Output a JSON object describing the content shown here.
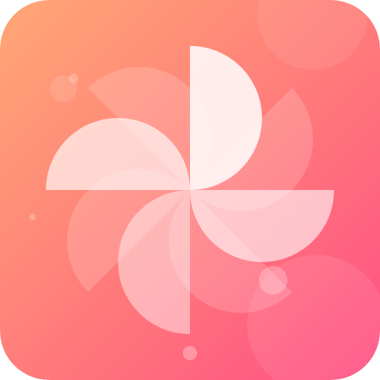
{
  "icon": {
    "name": "pinwheel-photos-app-icon",
    "gradient_start": "#FFA776",
    "gradient_mid": "#FF7D7A",
    "gradient_end": "#FF4E84",
    "petal_color": "#FFFFFF"
  }
}
